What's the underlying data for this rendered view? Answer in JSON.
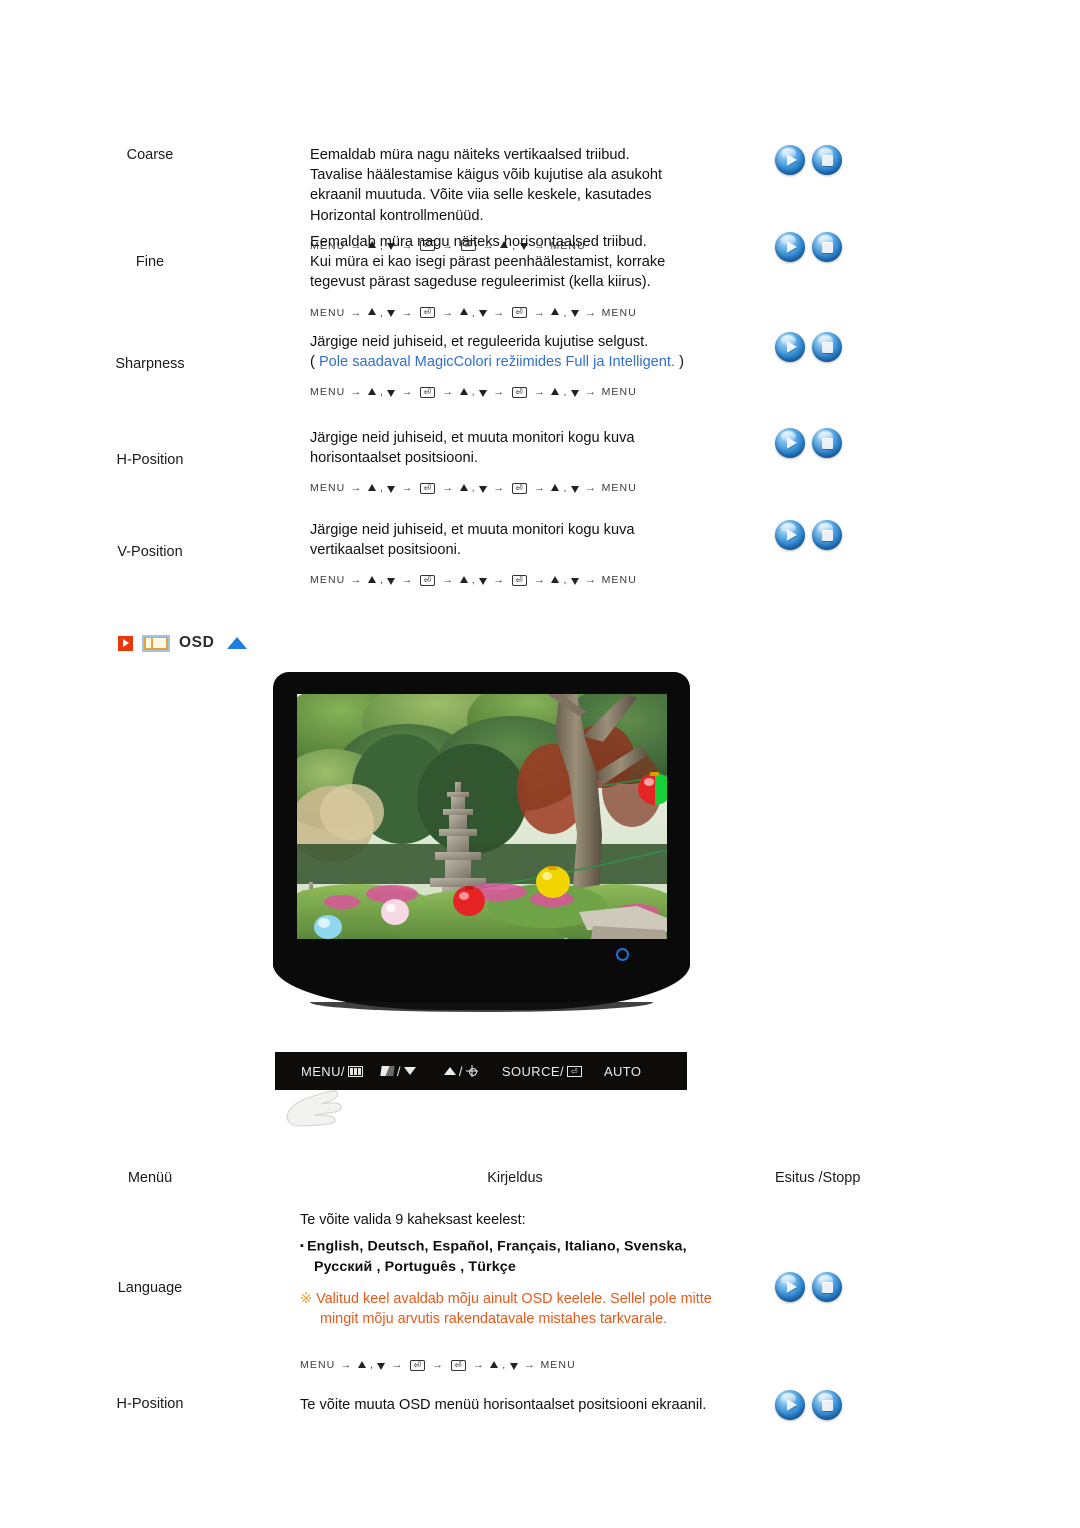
{
  "sections": {
    "top_rows": [
      {
        "menu": "Coarse",
        "desc_lines": [
          "Eemaldab müra nagu näiteks vertikaalsed triibud.",
          "Tavalise häälestamise käigus võib kujutise ala asukoht",
          "ekraanil muutuda. Võite viia selle keskele, kasutades",
          "Horizontal kontrollmenüüd."
        ],
        "note": null,
        "nav": "MENU → ▲ , ▼ → ⏎ → ⏎ → ▲ , ▼ → MENU",
        "nav_pattern": "short",
        "buttons": [
          "play",
          "stop"
        ]
      },
      {
        "menu": "Fine",
        "desc_lines": [
          "Eemaldab müra nagu näiteks horisontaalsed triibud.",
          "Kui müra ei kao isegi pärast peenhäälestamist, korrake",
          "tegevust pärast sageduse reguleerimist (kella kiirus)."
        ],
        "note": null,
        "nav_pattern": "long",
        "buttons": [
          "play",
          "stop"
        ]
      },
      {
        "menu": "Sharpness",
        "desc_lines": [
          "Järgige neid juhiseid, et reguleerida kujutise selgust."
        ],
        "note": "Pole saadaval MagicColori režiimides Full ja Intelligent.",
        "note_open": "(",
        "note_close": ")",
        "nav_pattern": "long",
        "buttons": [
          "play",
          "stop"
        ]
      },
      {
        "menu": "H-Position",
        "desc_lines": [
          "Järgige neid juhiseid, et muuta monitori kogu kuva",
          "horisontaalset positsiooni."
        ],
        "note": null,
        "nav_pattern": "long",
        "buttons": [
          "play",
          "stop"
        ]
      },
      {
        "menu": "V-Position",
        "desc_lines": [
          "Järgige neid juhiseid, et muuta monitori kogu kuva",
          "vertikaalset positsiooni."
        ],
        "note": null,
        "nav_pattern": "long",
        "buttons": [
          "play",
          "stop"
        ]
      }
    ],
    "osd_header": {
      "title": "OSD",
      "icons": [
        "red-play-icon",
        "window-icon",
        "blue-up-arrow-icon"
      ]
    },
    "monitor": {
      "led_name": "power-led-indicator",
      "buttons": [
        {
          "label": "MENU/",
          "icon": "menu-grid-icon"
        },
        {
          "label": "/",
          "icon_left": "contrast-icon",
          "icon_right": "down-arrow-icon"
        },
        {
          "label": "/",
          "icon_left": "up-arrow-icon",
          "icon_right": "brightness-sun-icon"
        },
        {
          "label": "SOURCE/",
          "icon": "enter-key-icon"
        },
        {
          "label": "AUTO",
          "icon": null
        }
      ]
    },
    "table_header": {
      "menu": "Menüü",
      "description": "Kirjeldus",
      "play_stop": "Esitus /Stopp"
    },
    "bottom_rows": [
      {
        "menu": "Language",
        "intro": "Te võite valida 9 kaheksast keelest:",
        "lang_line_1": "English, Deutsch, Español, Français,  Italiano, Svenska,",
        "lang_line_2": "Русский , Português , Türkçe",
        "warn_mark": "※",
        "warn_line_1": "Valitud keel avaldab mõju ainult OSD keelele. Sellel pole mitte",
        "warn_line_2": "mingit mõju arvutis rakendatavale mistahes tarkvarale.",
        "nav_pattern": "short",
        "buttons": [
          "play",
          "stop"
        ]
      },
      {
        "menu": "H-Position",
        "desc_lines": [
          "Te võite muuta OSD menüü horisontaalset positsiooni ekraanil."
        ],
        "buttons": [
          "play",
          "stop"
        ]
      }
    ]
  },
  "colors": {
    "note_blue": "#2f6fd0",
    "warn_orange": "#e8591a",
    "accent_red": "#e8380d",
    "accent_blue": "#1f7fe0",
    "button_blue": "#2b84cf",
    "led_blue": "#1f6fd6"
  },
  "nav_tokens": {
    "menu": "MENU",
    "enter": "⏎",
    "arrow": "→",
    "comma": ","
  }
}
